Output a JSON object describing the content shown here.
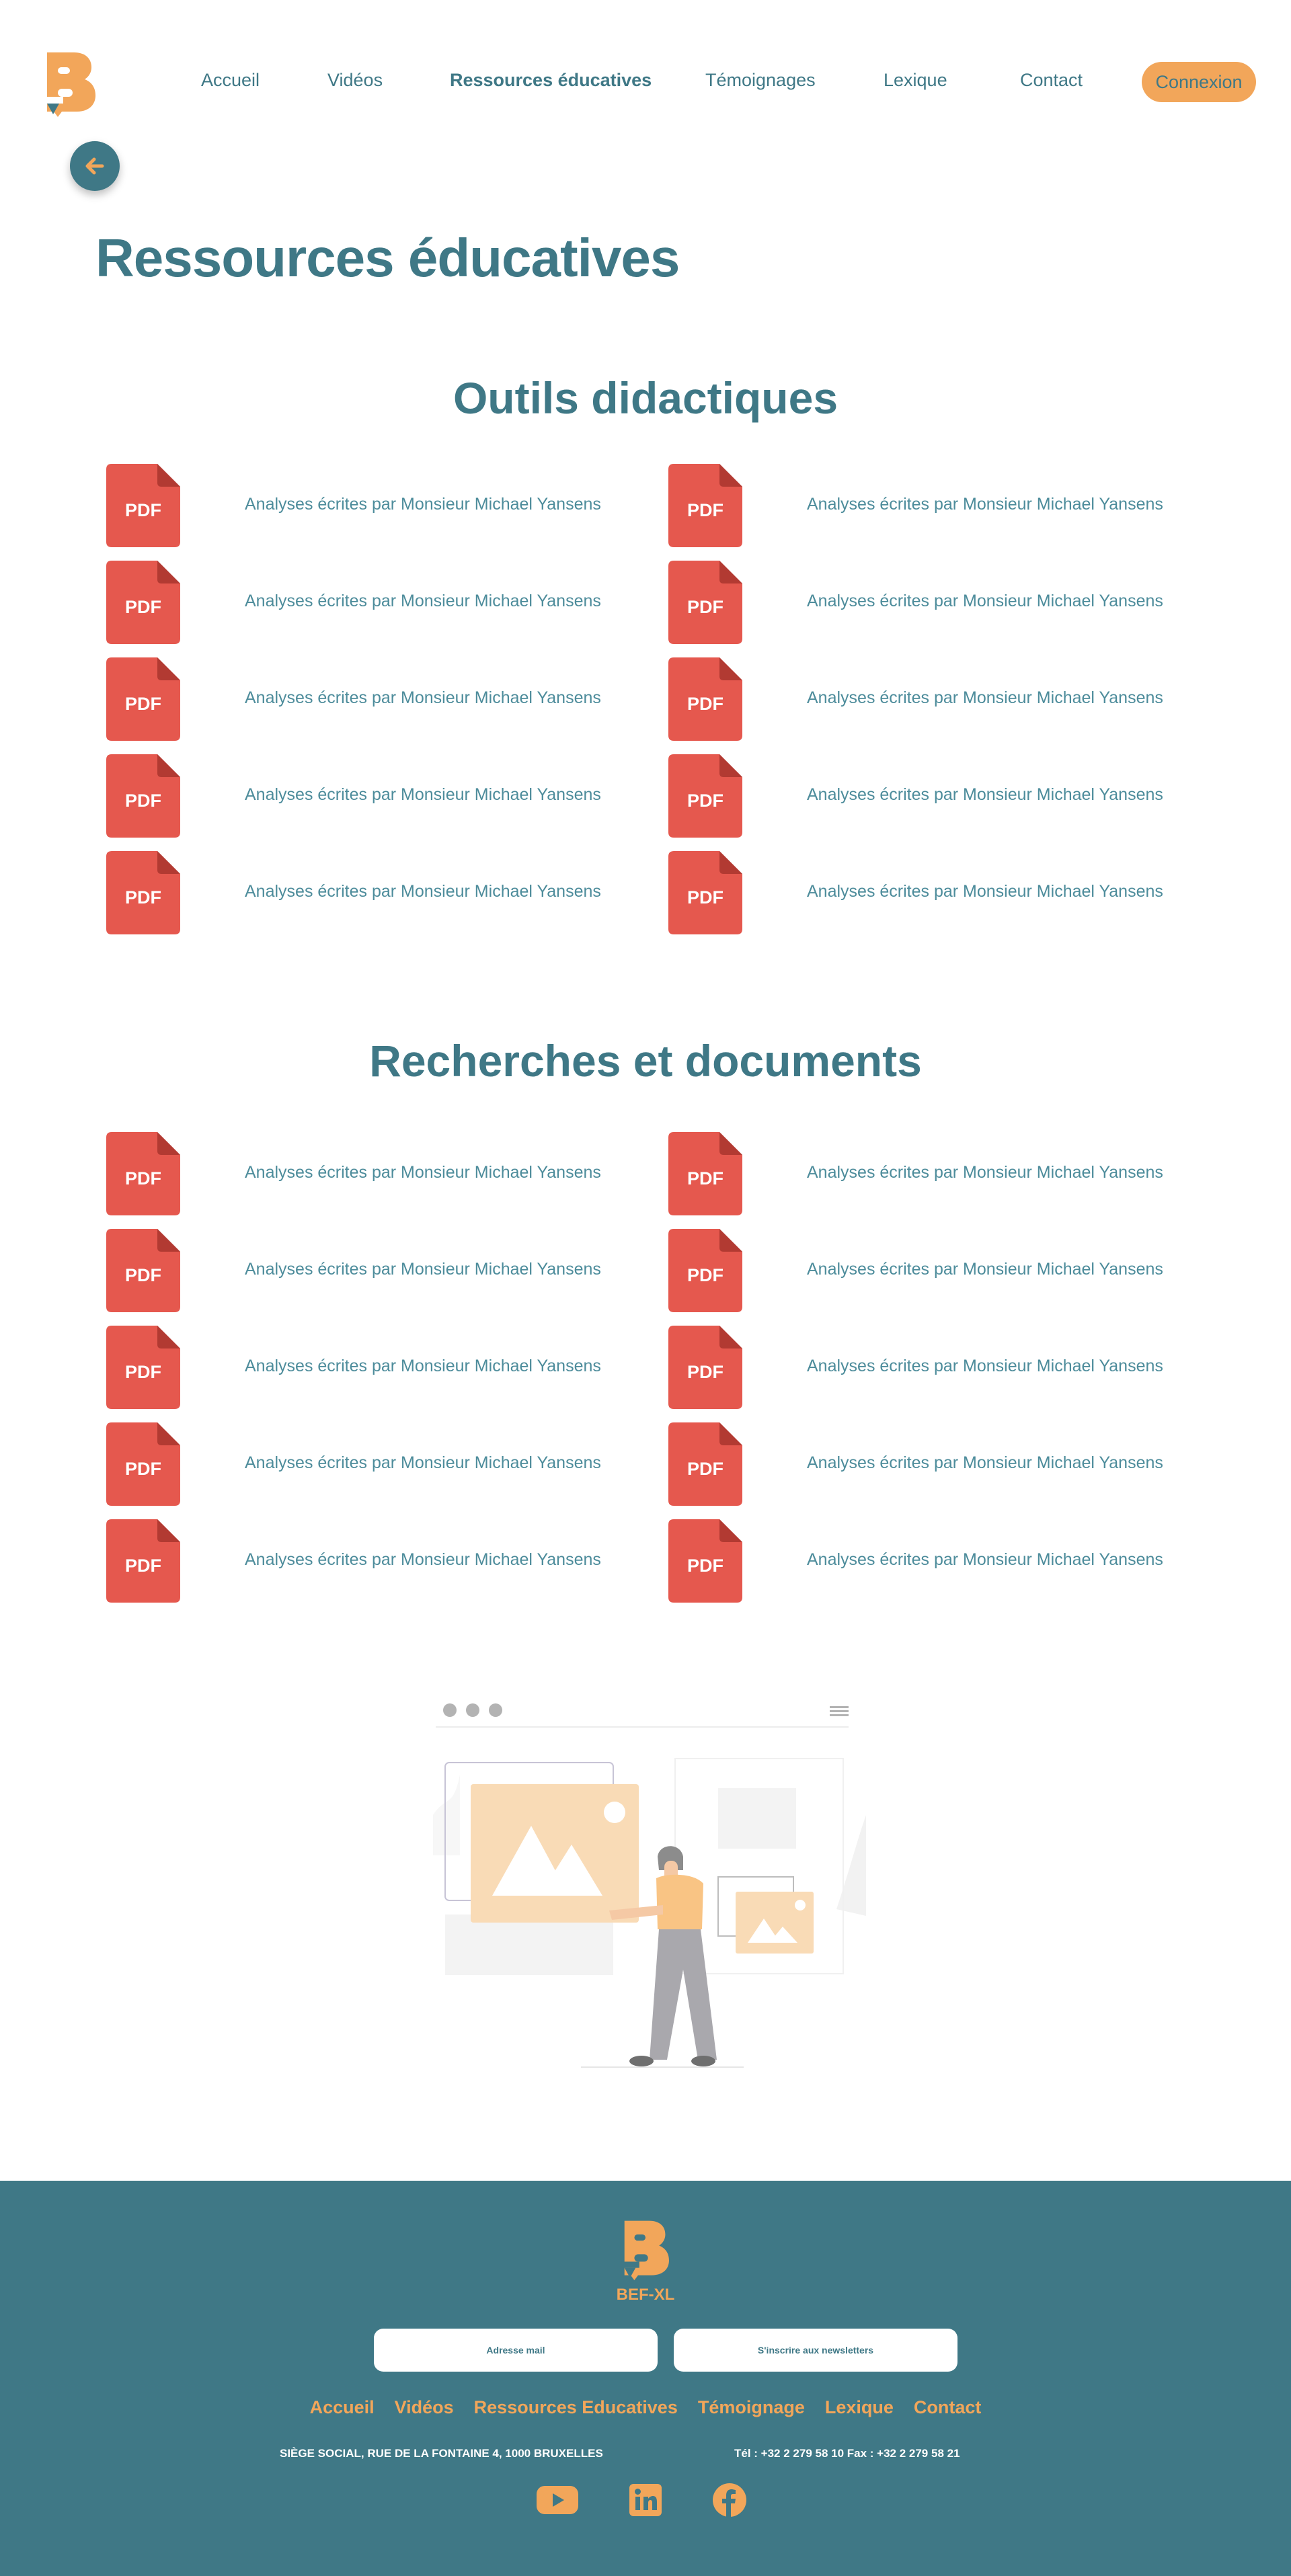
{
  "nav": {
    "links": [
      "Accueil",
      "Vidéos",
      "Ressources éducatives",
      "Témoignages",
      "Lexique",
      "Contact"
    ],
    "active_index": 2,
    "login": "Connexion"
  },
  "page": {
    "title": "Ressources éducatives"
  },
  "sections": [
    {
      "title": "Outils didactiques",
      "icon_text": "PDF",
      "documents": [
        "Analyses écrites par Monsieur Michael Yansens",
        "Analyses écrites par Monsieur Michael Yansens",
        "Analyses écrites par Monsieur Michael Yansens",
        "Analyses écrites par Monsieur Michael Yansens",
        "Analyses écrites par Monsieur Michael Yansens",
        "Analyses écrites par Monsieur Michael Yansens",
        "Analyses écrites par Monsieur Michael Yansens",
        "Analyses écrites par Monsieur Michael Yansens",
        "Analyses écrites par Monsieur Michael Yansens",
        "Analyses écrites par Monsieur Michael Yansens"
      ]
    },
    {
      "title": "Recherches et documents",
      "icon_text": "PDF",
      "documents": [
        "Analyses écrites par Monsieur Michael Yansens",
        "Analyses écrites par Monsieur Michael Yansens",
        "Analyses écrites par Monsieur Michael Yansens",
        "Analyses écrites par Monsieur Michael Yansens",
        "Analyses écrites par Monsieur Michael Yansens",
        "Analyses écrites par Monsieur Michael Yansens",
        "Analyses écrites par Monsieur Michael Yansens",
        "Analyses écrites par Monsieur Michael Yansens",
        "Analyses écrites par Monsieur Michael Yansens",
        "Analyses écrites par Monsieur Michael Yansens"
      ]
    }
  ],
  "footer": {
    "brand": "BEF-XL",
    "email_field": "Adresse mail",
    "newsletter_button": "S'inscrire aux newsletters",
    "links": [
      "Accueil",
      "Vidéos",
      "Ressources Educatives",
      "Témoignage",
      "Lexique",
      "Contact"
    ],
    "address": "SIÈGE SOCIAL, RUE DE LA FONTAINE 4, 1000 BRUXELLES",
    "phone": "Tél : +32 2 279 58 10 Fax : +32 2 279 58 21",
    "social_icons": [
      "youtube-icon",
      "linkedin-icon",
      "facebook-icon"
    ]
  },
  "colors": {
    "primary": "#3f7886",
    "accent": "#f2a65a",
    "pdf_red": "#e5584e"
  }
}
